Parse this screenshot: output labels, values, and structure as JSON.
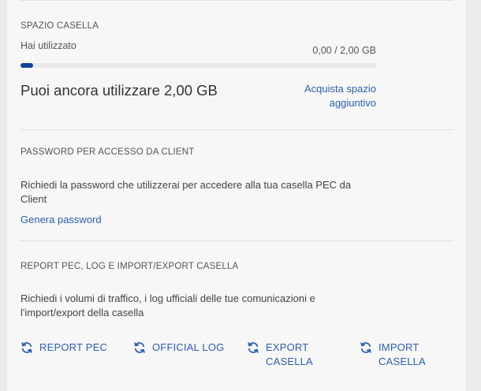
{
  "storage": {
    "heading": "SPAZIO CASELLA",
    "used_label": "Hai utilizzato",
    "usage_text": "0,00 / 2,00 GB",
    "used_fraction": 0.035,
    "remaining_text": "Puoi ancora utilizzare 2,00 GB",
    "buy_line1": "Acquista spazio",
    "buy_line2": "aggiuntivo"
  },
  "password": {
    "heading": "PASSWORD PER ACCESSO DA CLIENT",
    "description": "Richiedi la password che utilizzerai per accedere alla tua casella PEC da Client",
    "link": "Genera password"
  },
  "reports": {
    "heading": "REPORT PEC, LOG E IMPORT/EXPORT CASELLA",
    "description": "Richiedi i volumi di traffico, i log ufficiali delle tue comunicazioni e l'import/export della casella",
    "actions": [
      {
        "label": "REPORT PEC",
        "icon": "refresh-icon"
      },
      {
        "label": "OFFICIAL LOG",
        "icon": "refresh-icon"
      },
      {
        "label": "EXPORT CASELLA",
        "icon": "refresh-icon"
      },
      {
        "label": "IMPORT CASELLA",
        "icon": "refresh-icon"
      }
    ]
  },
  "colors": {
    "accent": "#12439c",
    "link": "#2c5fb3"
  }
}
